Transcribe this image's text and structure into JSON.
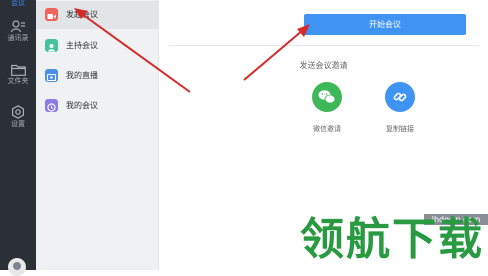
{
  "rail": {
    "items": [
      {
        "label": "会议",
        "icon": "video-icon"
      },
      {
        "label": "通讯录",
        "icon": "contacts-icon"
      },
      {
        "label": "文件夹",
        "icon": "folder-icon"
      },
      {
        "label": "设置",
        "icon": "gear-icon"
      }
    ]
  },
  "sidebar": {
    "items": [
      {
        "label": "发起会议",
        "color": "#f0625a"
      },
      {
        "label": "主持会议",
        "color": "#45c39a"
      },
      {
        "label": "我的直播",
        "color": "#4a90e2"
      },
      {
        "label": "我的会议",
        "color": "#8c7ae6"
      }
    ]
  },
  "main": {
    "top_caption": "",
    "start_button": "开始会议",
    "invite_title": "发送会议邀请",
    "actions": [
      {
        "label": "微信邀请",
        "color": "#3db757",
        "icon": "wechat-icon"
      },
      {
        "label": "复制链接",
        "color": "#3f94f3",
        "icon": "link-icon"
      }
    ]
  },
  "watermark": {
    "url": "lhdown.com",
    "text": "领航下载"
  },
  "colors": {
    "accent": "#3f94f3",
    "rail_bg": "#2b2f36",
    "arrow": "#d42a2a"
  }
}
